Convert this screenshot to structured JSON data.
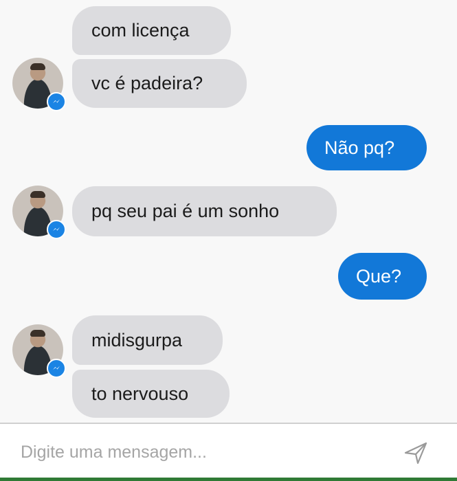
{
  "conversation": {
    "messages": [
      {
        "sender": "contact",
        "text": "com licença"
      },
      {
        "sender": "contact",
        "text": "vc é padeira?"
      },
      {
        "sender": "me",
        "text": "Não pq?"
      },
      {
        "sender": "contact",
        "text": "pq seu pai é um sonho"
      },
      {
        "sender": "me",
        "text": "Que?"
      },
      {
        "sender": "contact",
        "text": "midisgurpa"
      },
      {
        "sender": "contact",
        "text": "to nervouso"
      }
    ]
  },
  "composer": {
    "placeholder": "Digite uma mensagem...",
    "value": ""
  },
  "icons": {
    "avatar_badge": "messenger-icon",
    "send": "send-icon"
  },
  "colors": {
    "incoming_bubble": "#dcdcdf",
    "outgoing_bubble": "#1278d8",
    "badge": "#1b84e4"
  }
}
